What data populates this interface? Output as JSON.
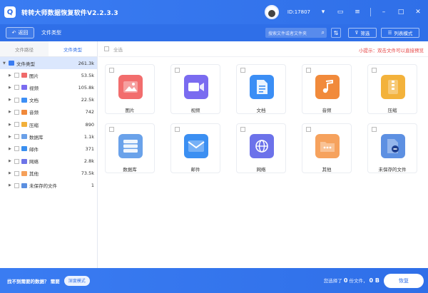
{
  "app": {
    "title": "转转大师数据恢复软件V2.2.3.3",
    "user_id": "ID:17807"
  },
  "toolbar": {
    "back_label": "返回",
    "crumb": "文件类型",
    "search_placeholder": "搜索文件或者文件夹",
    "filter_label": "筛选",
    "list_label": "列表模式"
  },
  "sidebar": {
    "tabs": [
      {
        "label": "文件路径"
      },
      {
        "label": "文件类型"
      }
    ],
    "root": {
      "label": "文件类型",
      "count": "261.3k"
    },
    "items": [
      {
        "label": "图片",
        "count": "53.5k",
        "color": "#f06a6a"
      },
      {
        "label": "视频",
        "count": "105.8k",
        "color": "#7b6cf0"
      },
      {
        "label": "文档",
        "count": "22.5k",
        "color": "#3d8ff5"
      },
      {
        "label": "音频",
        "count": "742",
        "color": "#f0893a"
      },
      {
        "label": "压缩",
        "count": "890",
        "color": "#f2b03a"
      },
      {
        "label": "数据库",
        "count": "1.1k",
        "color": "#6aa0e8"
      },
      {
        "label": "邮件",
        "count": "371",
        "color": "#3a8ff0"
      },
      {
        "label": "网络",
        "count": "2.8k",
        "color": "#6d74e8"
      },
      {
        "label": "其他",
        "count": "73.5k",
        "color": "#f5a05a"
      },
      {
        "label": "未保存的文件",
        "count": "1",
        "color": "#5b8fe0"
      }
    ]
  },
  "main": {
    "select_all": "全选",
    "tip": "小提示：双击文件可以直接预览",
    "cards": [
      {
        "label": "图片",
        "color": "#f26d6d",
        "icon": "image-icon"
      },
      {
        "label": "视频",
        "color": "#7a6bf0",
        "icon": "video-icon"
      },
      {
        "label": "文档",
        "color": "#3b8ef5",
        "icon": "document-icon"
      },
      {
        "label": "音频",
        "color": "#f18a3b",
        "icon": "audio-icon"
      },
      {
        "label": "压缩",
        "color": "#f3b23b",
        "icon": "archive-icon"
      },
      {
        "label": "数据库",
        "color": "#6aa2ea",
        "icon": "database-icon"
      },
      {
        "label": "邮件",
        "color": "#3b8ff2",
        "icon": "mail-icon"
      },
      {
        "label": "网络",
        "color": "#6c72ea",
        "icon": "network-icon"
      },
      {
        "label": "其他",
        "color": "#f6a25d",
        "icon": "folder-icon"
      },
      {
        "label": "未保存的文件",
        "color": "#5d90e2",
        "icon": "unsaved-file-icon"
      }
    ]
  },
  "footer": {
    "question": "找不到需要的数据？ 需要",
    "deep_mode": "深度模式",
    "selected_prefix": "您选择了",
    "selected_count": "0",
    "selected_unit": "份文件，",
    "size_value": "0 B",
    "recover_label": "恢复"
  }
}
